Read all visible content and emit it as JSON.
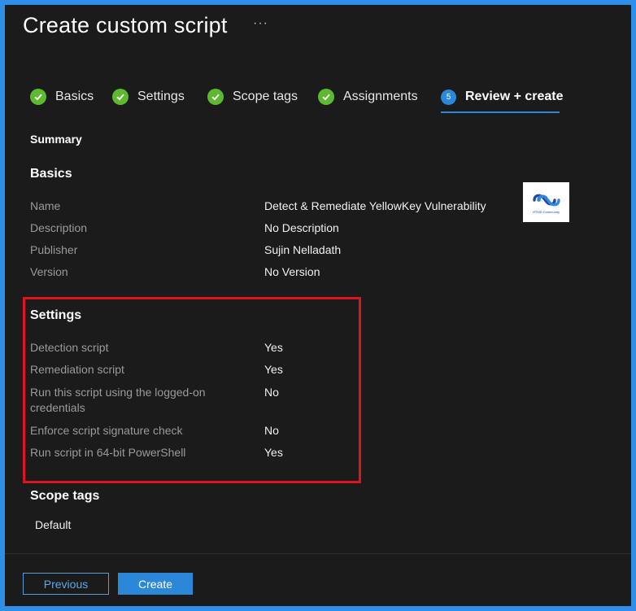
{
  "window": {
    "title": "Create custom script",
    "more_label": "···"
  },
  "wizard": {
    "steps": [
      {
        "label": "Basics",
        "state": "complete"
      },
      {
        "label": "Settings",
        "state": "complete"
      },
      {
        "label": "Scope tags",
        "state": "complete"
      },
      {
        "label": "Assignments",
        "state": "complete"
      },
      {
        "label": "Review + create",
        "state": "active",
        "number": "5"
      }
    ]
  },
  "summary": {
    "heading": "Summary"
  },
  "basics": {
    "heading": "Basics",
    "rows": [
      {
        "label": "Name",
        "value": "Detect & Remediate YellowKey Vulnerability"
      },
      {
        "label": "Description",
        "value": "No Description"
      },
      {
        "label": "Publisher",
        "value": "Sujin Nelladath"
      },
      {
        "label": "Version",
        "value": "No Version"
      }
    ]
  },
  "watermark": {
    "text": "HTMD Community"
  },
  "settings": {
    "heading": "Settings",
    "rows": [
      {
        "label": "Detection script",
        "value": "Yes"
      },
      {
        "label": "Remediation script",
        "value": "Yes"
      },
      {
        "label": "Run this script using the logged-on credentials",
        "value": "No"
      },
      {
        "label": "Enforce script signature check",
        "value": "No"
      },
      {
        "label": "Run script in 64-bit PowerShell",
        "value": "Yes"
      }
    ]
  },
  "scope_tags": {
    "heading": "Scope tags",
    "values": [
      "Default"
    ]
  },
  "footer": {
    "previous_label": "Previous",
    "create_label": "Create"
  },
  "colors": {
    "accent": "#2b88d8",
    "check": "#5cb930",
    "highlight": "#e0141e",
    "background": "#1b1b1b"
  }
}
